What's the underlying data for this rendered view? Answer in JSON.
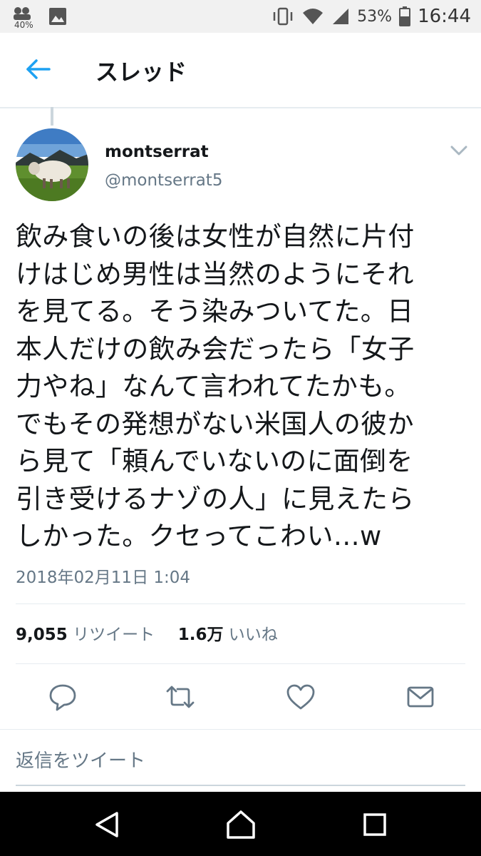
{
  "status_bar": {
    "signal_small": "40%",
    "battery": "53%",
    "time": "16:44",
    "icons": [
      "notification-icon",
      "image-icon",
      "vibrate-icon",
      "wifi-icon",
      "cell-signal-icon",
      "battery-icon"
    ]
  },
  "header": {
    "title": "スレッド",
    "back_icon": "back-arrow-icon"
  },
  "tweet": {
    "display_name": "montserrat",
    "handle": "@montserrat5",
    "text": "飲み食いの後は女性が自然に片付\nけはじめ男性は当然のようにそれ\nを見てる。そう染みついてた。日\n本人だけの飲み会だったら「女子\n力やね」なんて言われてたかも。\nでもその発想がない米国人の彼か\nら見て「頼んでいないのに面倒を\n引き受けるナゾの人」に見えたら\nしかった。クセってこわい…w",
    "timestamp": "2018年02月11日 1:04",
    "retweets_count": "9,055",
    "retweets_label": "リツイート",
    "likes_count": "1.6万",
    "likes_label": "いいね"
  },
  "actions": [
    "reply-icon",
    "retweet-icon",
    "like-icon",
    "direct-message-icon"
  ],
  "reply": {
    "placeholder": "返信をツイート"
  },
  "colors": {
    "accent": "#1da1f2",
    "text": "#14171a",
    "secondary": "#657786",
    "divider": "#e6ecf0"
  }
}
